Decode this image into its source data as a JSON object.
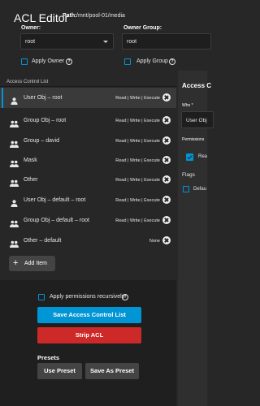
{
  "header": {
    "title": "ACL Editor",
    "path_label": "Path:",
    "path_value": "/mnt/pool-01/media"
  },
  "owner": {
    "label": "Owner:",
    "value": "root",
    "apply_label": "Apply Owner"
  },
  "owner_group": {
    "label": "Owner Group:",
    "value": "root",
    "apply_label": "Apply Group"
  },
  "acl_list": {
    "section_label": "Access Control List",
    "items": [
      {
        "icon": "user-icon",
        "name": "User Obj – root",
        "perms": "Read | Write | Execute",
        "selected": true
      },
      {
        "icon": "group-icon",
        "name": "Group Obj – root",
        "perms": "Read | Write | Execute"
      },
      {
        "icon": "group-icon",
        "name": "Group – david",
        "perms": "Read | Write | Execute"
      },
      {
        "icon": "group-icon",
        "name": "Mask",
        "perms": "Read | Write | Execute"
      },
      {
        "icon": "group-icon",
        "name": "Other",
        "perms": "Read | Write | Execute"
      },
      {
        "icon": "user-icon",
        "name": "User Obj – default – root",
        "perms": "Read | Write | Execute"
      },
      {
        "icon": "group-icon",
        "name": "Group Obj – default – root",
        "perms": "Read | Write | Execute"
      },
      {
        "icon": "group-icon",
        "name": "Other – default",
        "perms": "None"
      }
    ],
    "add_label": "Add Item"
  },
  "actions": {
    "recursive_label": "Apply permissions recursively",
    "save_label": "Save Access Control List",
    "strip_label": "Strip ACL",
    "presets_label": "Presets",
    "use_preset_label": "Use Preset",
    "save_as_preset_label": "Save As Preset"
  },
  "right_panel": {
    "title": "Access C",
    "who_label": "Who *",
    "who_value": "User Obj",
    "permissions_label": "Permissions",
    "read_label": "Rea",
    "flags_label": "Flags",
    "default_label": "Defau"
  },
  "colors": {
    "accent": "#0095d5",
    "danger": "#ce2929",
    "background": "#272727"
  }
}
